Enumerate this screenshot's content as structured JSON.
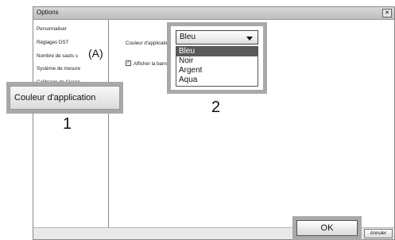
{
  "window": {
    "title": "Options",
    "close_glyph": "✕"
  },
  "sidebar": {
    "items": [
      {
        "label": "Personnaliser"
      },
      {
        "label": "Réglages DST"
      },
      {
        "label": "Nombre de sauts s"
      },
      {
        "label": "Système de mesure"
      },
      {
        "label": "Calibrage de l'écran"
      }
    ]
  },
  "content": {
    "color_label": "Couleur d'application",
    "checkbox_label": "Afficher la barre d",
    "checkbox_checked": true
  },
  "callouts": {
    "one": {
      "label": "Couleur d'application",
      "number": "1"
    },
    "two": {
      "number": "2"
    },
    "marker": "(A)"
  },
  "dropdown": {
    "selected": "Bleu",
    "options": [
      "Bleu",
      "Noir",
      "Argent",
      "Aqua"
    ],
    "highlighted_index": 0
  },
  "buttons": {
    "ok": "OK",
    "cancel": "Annuler"
  },
  "colors": {
    "callout_frame": "#a9a9a9",
    "highlight": "#5a5a5a"
  }
}
